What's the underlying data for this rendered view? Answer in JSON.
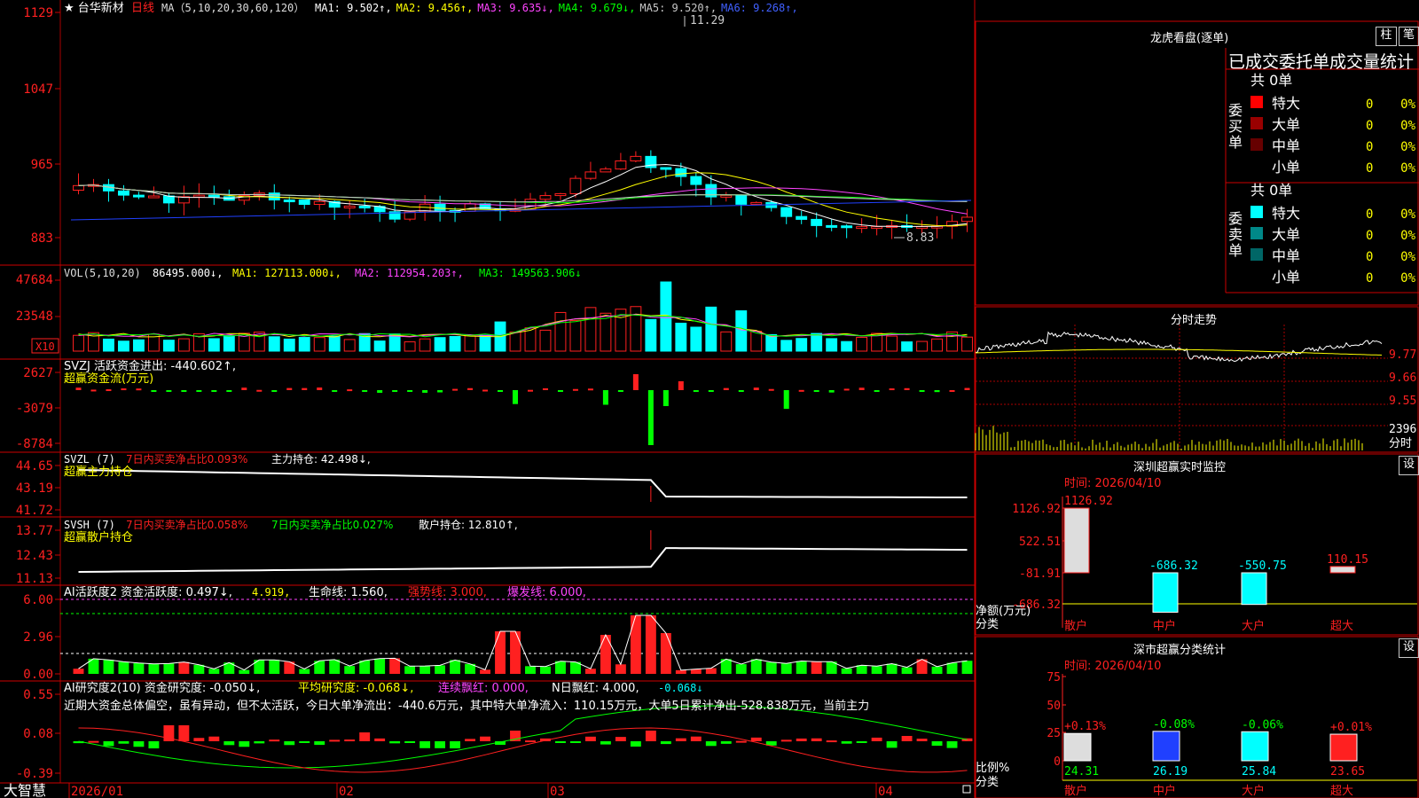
{
  "stock": {
    "name": "台华新材",
    "period": "日线",
    "star": "★"
  },
  "ma_line": {
    "title": "MA（5,10,20,30,60,120）",
    "items": [
      {
        "label": "MA1:",
        "value": "9.502",
        "arrow": "↑",
        "color": "#ffffff"
      },
      {
        "label": "MA2:",
        "value": "9.456",
        "arrow": "↑",
        "color": "#ffff00"
      },
      {
        "label": "MA3:",
        "value": "9.635",
        "arrow": "↓",
        "color": "#ff44ff"
      },
      {
        "label": "MA4:",
        "value": "9.679",
        "arrow": "↓",
        "color": "#00ff00"
      },
      {
        "label": "MA5:",
        "value": "9.520",
        "arrow": "↑",
        "color": "#c8c8c8"
      },
      {
        "label": "MA6:",
        "value": "9.268",
        "arrow": "↑",
        "color": "#4060ff"
      }
    ]
  },
  "price_axis": [
    "1129",
    "1047",
    "965",
    "883"
  ],
  "price_marks": {
    "high": "11.29",
    "low": "8.83"
  },
  "vol": {
    "title": "VOL(5,10,20)",
    "v0": "86495.000↓,",
    "ma1": "MA1: 127113.000↓,",
    "ma2": "MA2: 112954.203↑,",
    "ma3": "MA3: 149563.906↓",
    "axis": [
      "47684",
      "23548"
    ],
    "unit": "X10"
  },
  "svzj": {
    "title": "SVZJ  活跃资金进出: -440.602↑,",
    "sub": "超赢资金流(万元)",
    "axis": [
      "2627",
      "-3079",
      "-8784"
    ]
  },
  "svzl": {
    "title": "SVZL (7)",
    "t2": "7日内买卖净占比0.093%",
    "t3": "主力持仓: 42.498↓,",
    "sub": "超赢主力持仓",
    "axis": [
      "44.65",
      "43.19",
      "41.72"
    ]
  },
  "svsh": {
    "title": "SVSH (7)",
    "t2": "7日内买卖净占比0.058%",
    "t3": "7日内买卖净占比0.027%",
    "t4": "散户持仓: 12.810↑,",
    "sub": "超赢散户持仓",
    "axis": [
      "13.77",
      "12.43",
      "11.13"
    ]
  },
  "ai1": {
    "title": "AI活跃度2 资金活跃度: 0.497↓,",
    "t2": "4.919,",
    "t3": "生命线: 1.560,",
    "t4": "强势线: 3.000,",
    "t5": "爆发线: 6.000,",
    "axis": [
      "6.00",
      "2.96",
      "0.00"
    ]
  },
  "ai2": {
    "title": "AI研究度2(10) 资金研究度: -0.050↓,",
    "t2": "平均研究度: -0.068↓,",
    "t3": "连续飘红: 0.000,",
    "t4": "N日飘红: 4.000,",
    "t5": "-0.068↓",
    "comment": "近期大资金总体偏空，虽有异动，但不太活跃，今日大单净流出：-440.6万元，其中特大单净流入：110.15万元，大单5日累计净出-528.838万元，当前主力",
    "axis": [
      "0.55",
      "0.08",
      "-0.39"
    ]
  },
  "date_axis": [
    "2026/01",
    "02",
    "03",
    "04"
  ],
  "brand": "大智慧",
  "longhu": {
    "title": "龙虎看盘(逐单)",
    "btn1": "柱",
    "btn2": "笔",
    "header": "已成交委托单成交量统计",
    "buy_label": "委买单",
    "sell_label": "委卖单",
    "buy_total": "共 0单",
    "sell_total": "共 0单",
    "rows": [
      {
        "name": "特大",
        "count": "0",
        "pct": "0%"
      },
      {
        "name": "大单",
        "count": "0",
        "pct": "0%"
      },
      {
        "name": "中单",
        "count": "0",
        "pct": "0%"
      },
      {
        "name": "小单",
        "count": "0",
        "pct": "0%"
      }
    ],
    "buy_colors": [
      "#ff0000",
      "#990000",
      "#660000",
      "#000000"
    ],
    "sell_colors": [
      "#00ffff",
      "#008888",
      "#006666",
      "#000000"
    ]
  },
  "fenshi": {
    "title": "分时走势",
    "axis": [
      "9.77",
      "9.66",
      "9.55"
    ],
    "vol_axis": "2396",
    "vol_unit": "分时"
  },
  "shenzhen_monitor": {
    "title": "深圳超赢实时监控",
    "btn": "设",
    "time": "时间: 2026/04/10",
    "axis": [
      "1126.92",
      "522.51",
      "-81.91",
      "-686.32"
    ],
    "ylabel": "净额(万元)",
    "xlabel": "分类",
    "chart_data": {
      "type": "bar",
      "categories": [
        "散户",
        "中户",
        "大户",
        "超大"
      ],
      "values": [
        1126.92,
        -686.32,
        -550.75,
        110.15
      ],
      "value_labels": [
        "1126.92",
        "-686.32",
        "-550.75",
        "110.15"
      ],
      "ylim": [
        -686.32,
        1126.92
      ]
    }
  },
  "shenzhen_class": {
    "title": "深市超赢分类统计",
    "btn": "设",
    "time": "时间: 2026/04/10",
    "axis": [
      "75",
      "50",
      "25",
      "0"
    ],
    "ylabel": "比例%",
    "xlabel": "分类",
    "chart_data": {
      "type": "bar",
      "categories": [
        "散户",
        "中户",
        "大户",
        "超大"
      ],
      "values": [
        24.31,
        26.19,
        25.84,
        23.65
      ],
      "value_labels": [
        "24.31",
        "26.19",
        "25.84",
        "23.65"
      ],
      "changes": [
        "+0.13%",
        "-0.08%",
        "-0.06%",
        "+0.01%"
      ],
      "ylim": [
        0,
        75
      ]
    }
  }
}
